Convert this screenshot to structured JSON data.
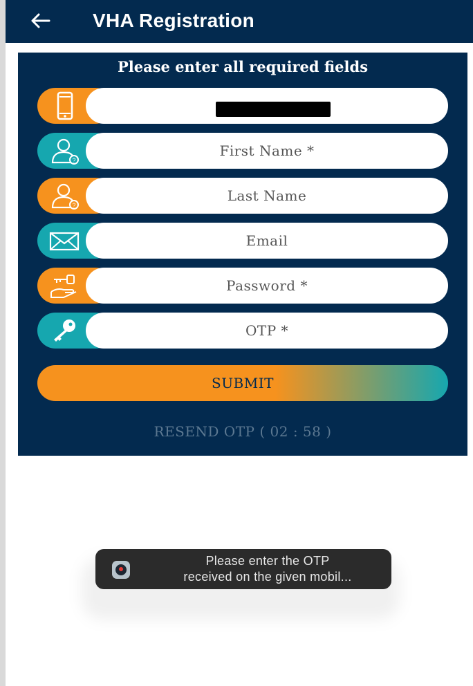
{
  "appbar": {
    "title": "VHA Registration",
    "back_icon": "arrow-left-icon"
  },
  "form": {
    "heading": "Please enter all required fields",
    "fields": [
      {
        "id": "mobile",
        "icon": "mobile-phone-icon",
        "placeholder": "",
        "value": "",
        "redacted": true,
        "icon_color": "#f6921e"
      },
      {
        "id": "first_name",
        "icon": "user-question-icon",
        "placeholder": "First Name *",
        "value": "",
        "icon_color": "#16a7af"
      },
      {
        "id": "last_name",
        "icon": "user-question-icon",
        "placeholder": "Last Name",
        "value": "",
        "icon_color": "#f6921e"
      },
      {
        "id": "email",
        "icon": "envelope-icon",
        "placeholder": "Email",
        "value": "",
        "icon_color": "#16a7af"
      },
      {
        "id": "password",
        "icon": "hand-key-icon",
        "placeholder": "Password *",
        "value": "",
        "icon_color": "#f6921e"
      },
      {
        "id": "otp",
        "icon": "key-icon",
        "placeholder": "OTP *",
        "value": "",
        "icon_color": "#16a7af"
      }
    ],
    "submit_label": "SUBMIT",
    "resend_label": "RESEND OTP ( 02 : 58 )"
  },
  "toast": {
    "line1": "Please enter the OTP",
    "line2": "received on the given mobil...",
    "icon": "app-icon"
  },
  "colors": {
    "navy": "#032a4f",
    "orange": "#f6921e",
    "teal": "#16a7af",
    "background": "#ffffff"
  }
}
